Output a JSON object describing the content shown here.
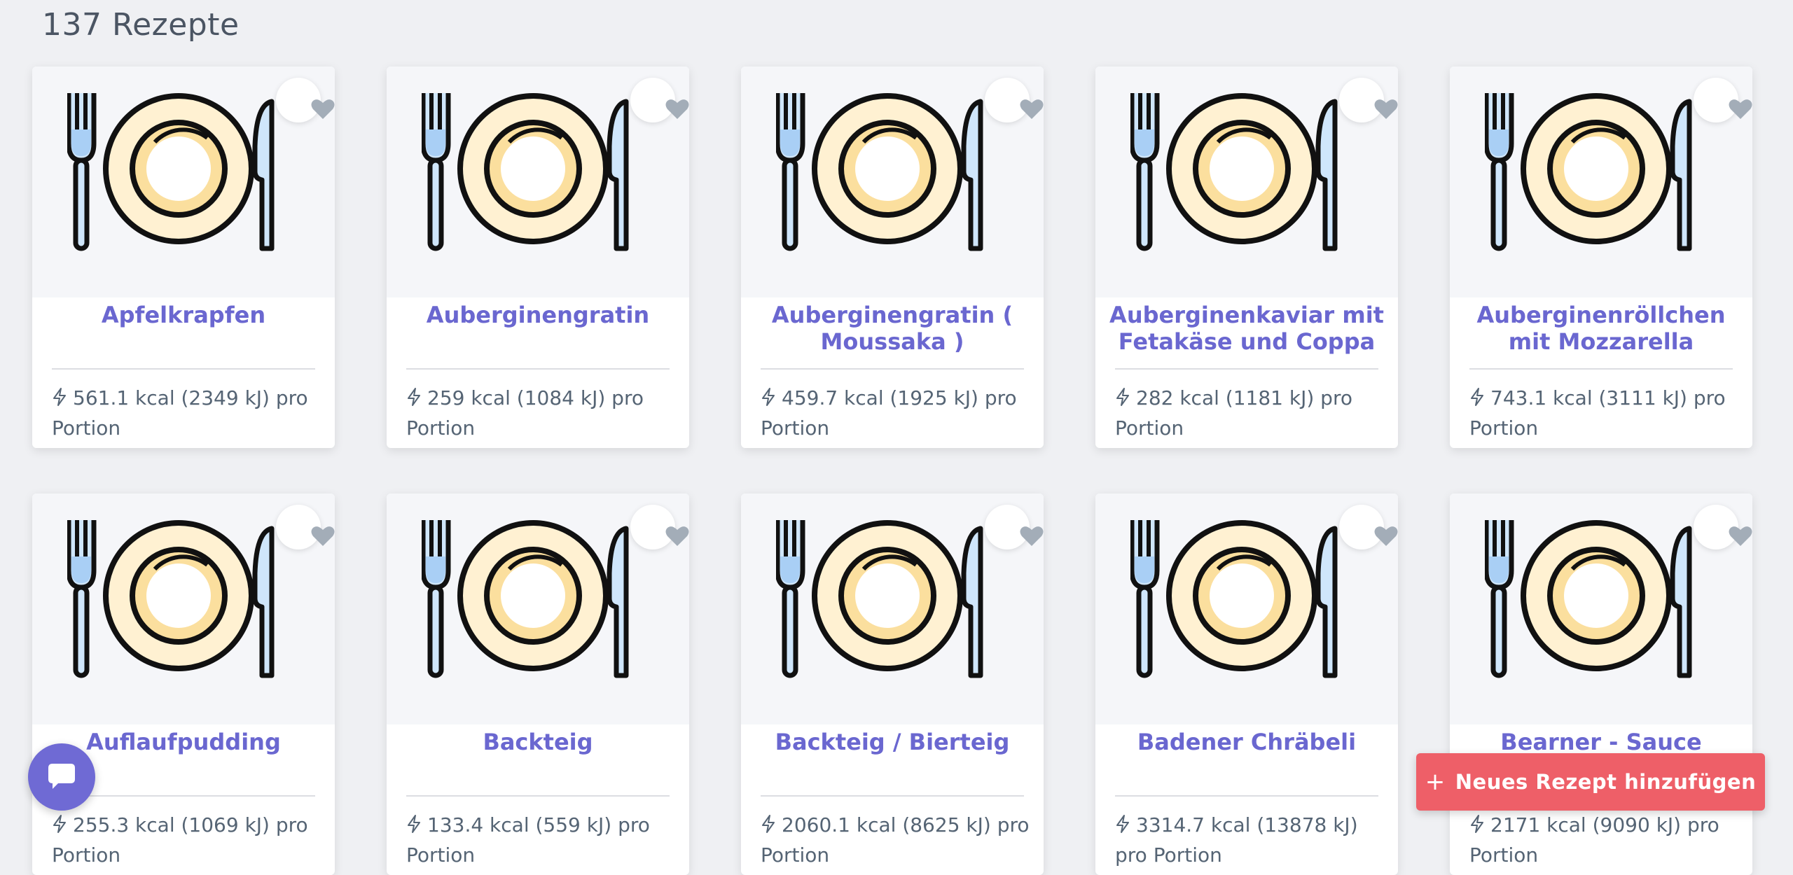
{
  "page": {
    "count_label": "137 Rezepte"
  },
  "recipes": [
    {
      "title": "Apfelkrapfen",
      "energy": "561.1 kcal (2349 kJ) pro Portion"
    },
    {
      "title": "Auberginengratin",
      "energy": "259 kcal (1084 kJ) pro Portion"
    },
    {
      "title": "Auberginengratin ( Moussaka )",
      "energy": "459.7 kcal (1925 kJ) pro Portion"
    },
    {
      "title": "Auberginenkaviar mit Fetakäse und Coppa",
      "energy": "282 kcal (1181 kJ) pro Portion"
    },
    {
      "title": "Auberginenröllchen mit Mozzarella",
      "energy": "743.1 kcal (3111 kJ) pro Portion"
    },
    {
      "title": "Auflaufpudding",
      "energy": "255.3 kcal (1069 kJ) pro Portion"
    },
    {
      "title": "Backteig",
      "energy": "133.4 kcal (559 kJ) pro Portion"
    },
    {
      "title": "Backteig / Bierteig",
      "energy": "2060.1 kcal (8625 kJ) pro Portion"
    },
    {
      "title": "Badener Chräbeli",
      "energy": "3314.7 kcal (13878 kJ) pro Portion"
    },
    {
      "title": "Bearner - Sauce",
      "energy": "2171 kcal (9090 kJ) pro Portion"
    }
  ],
  "actions": {
    "add_recipe_label": "Neues Rezept hinzufügen"
  },
  "icons": {
    "placeholder": "plate-cutlery-icon",
    "favorite": "heart-icon",
    "energy": "lightning-icon",
    "chat": "chat-bubble-icon",
    "add": "plus-icon"
  },
  "colors": {
    "accent": "#6a67d0",
    "button": "#ee5f68",
    "background": "#eff0f3"
  }
}
